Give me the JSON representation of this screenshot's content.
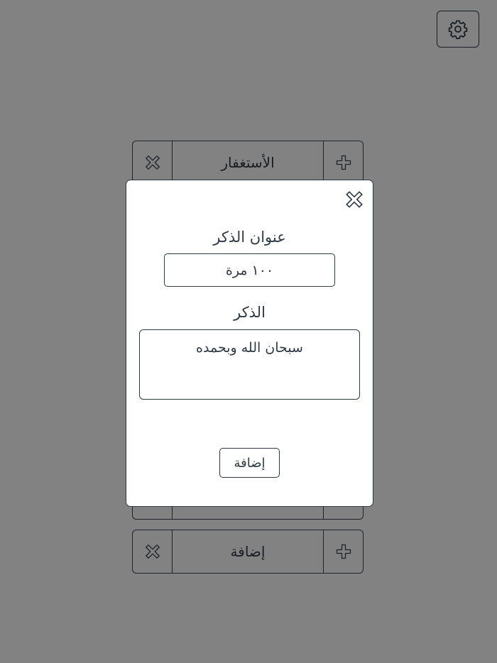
{
  "header": {
    "settings_icon": "gear-icon"
  },
  "list": {
    "rows": [
      {
        "label": "الأستغفار",
        "remove_icon": "x-cross-icon",
        "increment_icon": "plus-icon"
      },
      {
        "label": "",
        "remove_icon": "x-cross-icon",
        "increment_icon": "plus-icon"
      },
      {
        "label": "إضافة",
        "remove_icon": "x-cross-icon",
        "increment_icon": "plus-icon"
      }
    ]
  },
  "modal": {
    "close_icon": "x-cross-icon",
    "title_label": "عنوان الذكر",
    "title_placeholder": "١٠٠ مرة",
    "dhikr_label": "الذكر",
    "dhikr_value": "سبحان الله وبحمده",
    "add_button_label": "إضافة"
  },
  "colors": {
    "outline": "#2f3a45",
    "overlay": "rgba(0,0,0,0.49)",
    "surface": "#ffffff"
  }
}
